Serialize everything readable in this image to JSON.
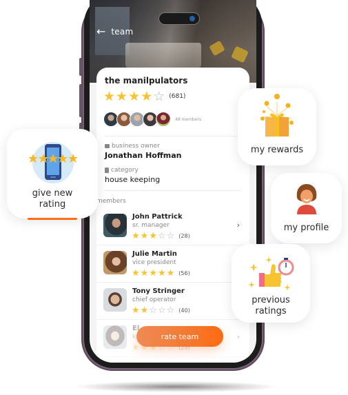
{
  "topbar": {
    "back_icon": "←",
    "title": "team"
  },
  "team": {
    "name": "the manilpulators",
    "rating": 4,
    "max_rating": 5,
    "review_count": "(681)",
    "members_count": "48 members",
    "owner_label": "business owner",
    "owner_name": "Jonathan Hoffman",
    "category_label": "category",
    "category_value": "house keeping"
  },
  "members_section": {
    "title": "members"
  },
  "members": [
    {
      "name": "John Pattrick",
      "role": "sr. manager",
      "rating": 3,
      "count": "(28)",
      "chevron": "›"
    },
    {
      "name": "Julie Martin",
      "role": "vice president",
      "rating": 5,
      "count": "(56)",
      "chevron": ""
    },
    {
      "name": "Tony Stringer",
      "role": "chief operator",
      "rating": 2,
      "count": "(40)",
      "chevron": ""
    },
    {
      "name": "El",
      "role": "k",
      "rating": 3,
      "count": "(29)",
      "chevron": "›"
    }
  ],
  "actions": {
    "rate_team": "rate team"
  },
  "tiles": {
    "give_new_rating": "give new rating",
    "my_rewards": "my rewards",
    "my_profile": "my profile",
    "previous_ratings": "previous ratings"
  },
  "glyphs": {
    "star_full": "★",
    "star_empty": "☆"
  },
  "colors": {
    "accent": "#ff6b17",
    "star": "#f7c32e",
    "phone_frame": "#7b6478"
  }
}
